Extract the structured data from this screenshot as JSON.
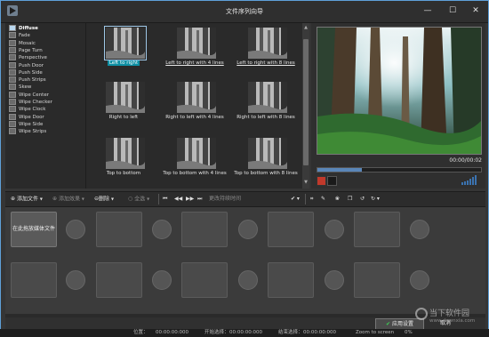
{
  "window": {
    "title": "文件序列向导",
    "minimize": "—",
    "maximize": "☐",
    "close": "✕"
  },
  "effects": [
    {
      "label": "Diffuse",
      "selected": true
    },
    {
      "label": "Fade"
    },
    {
      "label": "Mosaic"
    },
    {
      "label": "Page Turn"
    },
    {
      "label": "Perspective"
    },
    {
      "label": "Push Door"
    },
    {
      "label": "Push Side"
    },
    {
      "label": "Push Strips"
    },
    {
      "label": "Skew"
    },
    {
      "label": "Wipe Center"
    },
    {
      "label": "Wipe Checker"
    },
    {
      "label": "Wipe Clock"
    },
    {
      "label": "Wipe Door"
    },
    {
      "label": "Wipe Side"
    },
    {
      "label": "Wipe Strips"
    }
  ],
  "gallery": [
    {
      "label": "Left to right",
      "selected": true
    },
    {
      "label": "Left to right with 4 lines",
      "underline": true
    },
    {
      "label": "Left to right with 8 lines",
      "underline": true
    },
    {
      "label": "Right to left"
    },
    {
      "label": "Right to left with 4 lines"
    },
    {
      "label": "Right to left with 8 lines"
    },
    {
      "label": "Top to bottom"
    },
    {
      "label": "Top to bottom with 4 lines"
    },
    {
      "label": "Top to bottom with 8 lines"
    }
  ],
  "preview": {
    "time": "00:00/00:02",
    "progress": 0.27
  },
  "toolbar": {
    "add_file": "添加文件",
    "add_effect": "添加效果",
    "delete": "删除",
    "select_all": "全选",
    "duration": "更改持续时间"
  },
  "timeline": {
    "drop_label": "在此拖放媒体文件"
  },
  "footer": {
    "ok": "应用设置",
    "cancel": "取消"
  },
  "status": {
    "position": "位置：",
    "t1": "00:00:00:000",
    "start_label": "开始选择：",
    "t2": "00:00:00:000",
    "end_label": "结束选择：",
    "t3": "00:00:00:000",
    "zoom": "Zoom to screen",
    "zoom_pct": "0%"
  },
  "watermark": {
    "line1": "当下软件园",
    "line2": "www.downxia.com"
  },
  "colors": {
    "accent": "#0d8fa3",
    "window_border": "#5fa0d9",
    "progress": "#5a86b8"
  }
}
